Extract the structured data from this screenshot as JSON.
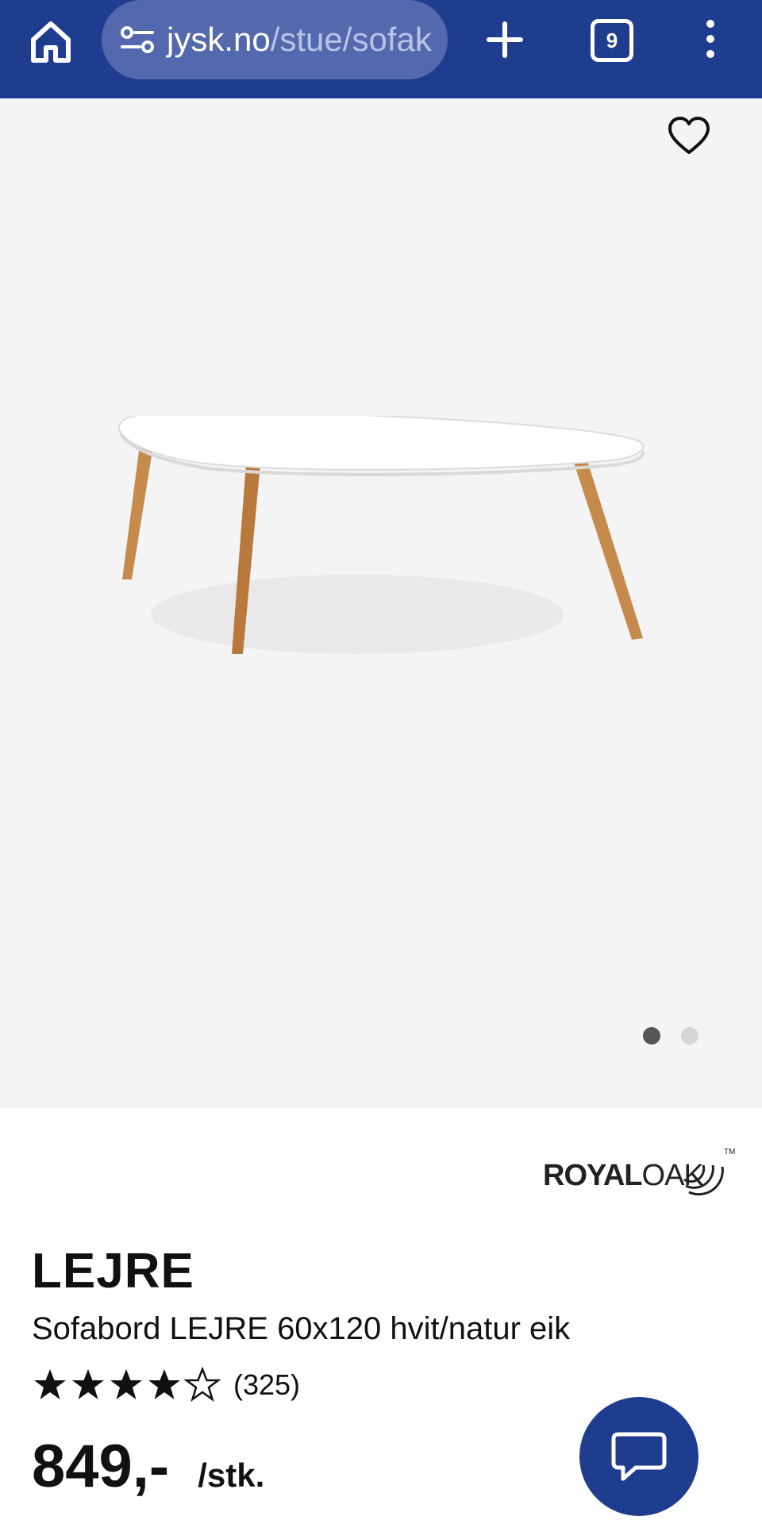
{
  "browser": {
    "url_host": "jysk.no",
    "url_path": "/stue/sofak",
    "tab_count": "9"
  },
  "gallery": {
    "image_count": 2,
    "active_index": 0
  },
  "brand": {
    "logo_text_bold": "ROYAL",
    "logo_text_light": "OAK",
    "trademark": "TM"
  },
  "product": {
    "name": "LEJRE",
    "description": "Sofabord LEJRE 60x120 hvit/natur eik",
    "rating": 4,
    "rating_max": 5,
    "review_count": "(325)",
    "price": "849,-",
    "unit": "/stk."
  },
  "colors": {
    "brand_blue": "#1f3d8f",
    "image_bg": "#f4f4f4"
  },
  "icons": {
    "home": "home-icon",
    "site_settings": "tune-icon",
    "new_tab": "plus-icon",
    "more": "more-vertical-icon",
    "favorite": "heart-icon",
    "chat": "chat-bubble-icon"
  }
}
